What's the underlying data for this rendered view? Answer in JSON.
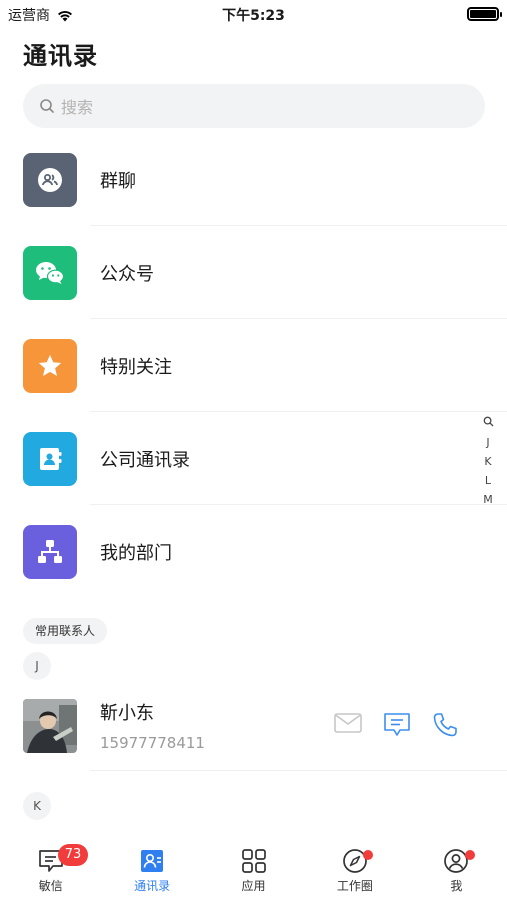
{
  "status_bar": {
    "carrier": "运营商",
    "time": "下午5:23"
  },
  "page": {
    "title": "通讯录"
  },
  "search": {
    "placeholder": "搜索"
  },
  "menu": [
    {
      "label": "群聊",
      "icon": "group-chat-icon",
      "color": "#5a6374"
    },
    {
      "label": "公众号",
      "icon": "wechat-icon",
      "color": "#1ebd7c"
    },
    {
      "label": "特别关注",
      "icon": "star-icon",
      "color": "#f7953b"
    },
    {
      "label": "公司通讯录",
      "icon": "contact-card-icon",
      "color": "#22a9e0"
    },
    {
      "label": "我的部门",
      "icon": "org-chart-icon",
      "color": "#6a5fdc"
    }
  ],
  "index_letters": [
    "J",
    "K",
    "L",
    "M"
  ],
  "frequent_section": {
    "label": "常用联系人"
  },
  "groups": [
    {
      "letter": "J",
      "contacts": [
        {
          "name": "靳小东",
          "phone": "15977778411"
        }
      ]
    },
    {
      "letter": "K",
      "contacts": []
    }
  ],
  "tabbar": [
    {
      "label": "敏信",
      "badge": "73",
      "active": false
    },
    {
      "label": "通讯录",
      "active": true
    },
    {
      "label": "应用",
      "active": false
    },
    {
      "label": "工作圈",
      "dot": true,
      "active": false
    },
    {
      "label": "我",
      "dot": true,
      "active": false
    }
  ],
  "colors": {
    "accent": "#2f7ff0",
    "badge": "#f23c3c",
    "action_icon": "#3c8df0"
  }
}
